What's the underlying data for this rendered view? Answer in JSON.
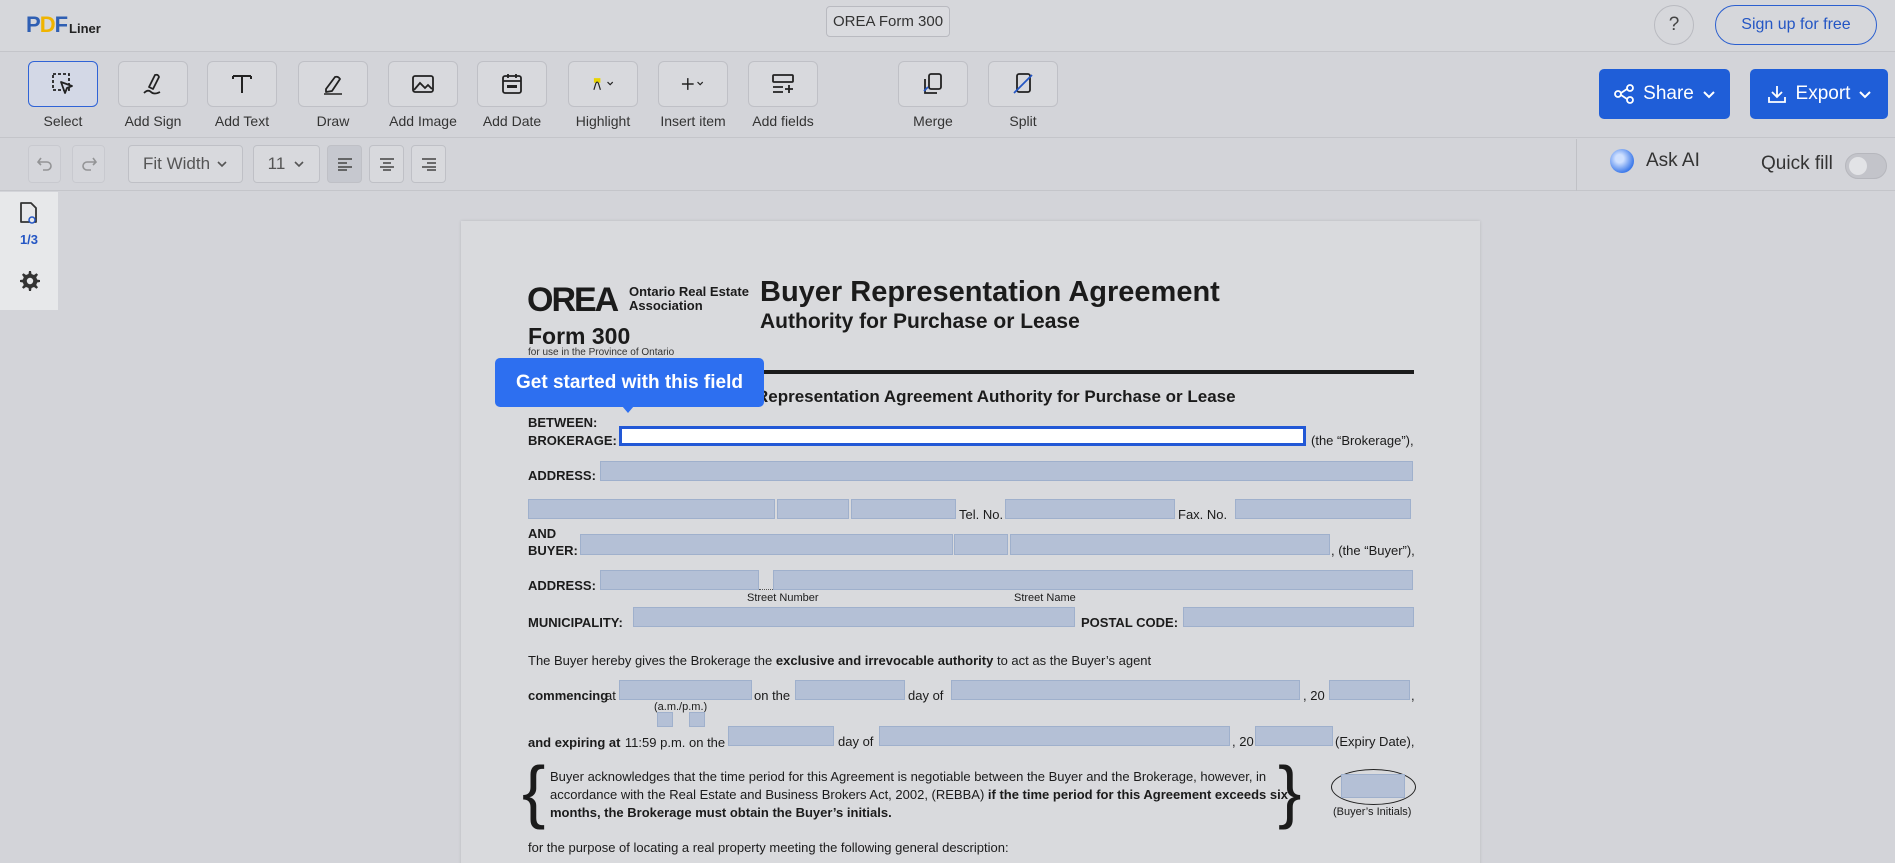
{
  "header": {
    "logo_pdf_p": "P",
    "logo_pdf_d": "D",
    "logo_pdf_f": "F",
    "logo_liner": "Liner",
    "doc_title": "OREA Form 300",
    "help": "?",
    "signup": "Sign up for free"
  },
  "toolbar": {
    "tools": [
      {
        "label": "Select",
        "icon": "select-icon"
      },
      {
        "label": "Add Sign",
        "icon": "pen-sign-icon"
      },
      {
        "label": "Add Text",
        "icon": "text-icon"
      },
      {
        "label": "Draw",
        "icon": "draw-icon"
      },
      {
        "label": "Add Image",
        "icon": "image-icon"
      },
      {
        "label": "Add Date",
        "icon": "calendar-icon"
      },
      {
        "label": "Highlight",
        "icon": "highlight-icon"
      },
      {
        "label": "Insert item",
        "icon": "plus-icon"
      },
      {
        "label": "Add fields",
        "icon": "fields-icon"
      },
      {
        "label": "Merge",
        "icon": "merge-icon"
      },
      {
        "label": "Split",
        "icon": "split-icon"
      }
    ],
    "share": "Share",
    "export": "Export"
  },
  "format": {
    "zoom": "Fit Width",
    "font_size": "11",
    "ask_ai": "Ask AI",
    "quick_fill": "Quick fill",
    "quick_fill_on": false
  },
  "sidebar": {
    "page_indicator": "1/3"
  },
  "tooltip": "Get started with this field",
  "form": {
    "orea_logo": "OREA",
    "assoc_line1": "Ontario Real Estate",
    "assoc_line2": "Association",
    "form_number": "Form 300",
    "form_sub": "for use in the Province of Ontario",
    "title": "Buyer Representation Agreement",
    "subtitle": "Authority for Purchase or Lease",
    "section_title": "Representation Agreement Authority for Purchase or Lease",
    "between": "BETWEEN:",
    "brokerage": "BROKERAGE:",
    "the_brokerage": "(the “Brokerage”),",
    "address": "ADDRESS:",
    "tel": "Tel. No.",
    "fax": "Fax. No.",
    "and": "AND",
    "buyer": "BUYER:",
    "the_buyer": ", (the “Buyer”),",
    "street_number": "Street Number",
    "street_name": "Street Name",
    "municipality": "MUNICIPALITY:",
    "postal_code": "POSTAL CODE:",
    "gives_pre": "The Buyer hereby gives the Brokerage the ",
    "gives_bold": "exclusive and irrevocable authority",
    "gives_post": " to act as the Buyer’s agent",
    "commencing": "commencing",
    "at": "at",
    "am_pm": "(a.m./p.m.)",
    "on_the": "on the",
    "day_of": "day of",
    "comma_20": ", 20",
    "comma": ",",
    "expiring_bold": "and expiring at",
    "expiring_time": "11:59 p.m. on the",
    "comma_20b": ", 20",
    "expiry_date": "(Expiry Date),",
    "ack_line1": "Buyer acknowledges that the time period for this Agreement is negotiable between the Buyer and the Brokerage, however, in",
    "ack_line2_pre": "accordance with the Real Estate and Business Brokers Act, 2002, (REBBA) ",
    "ack_line2_bold": "if the time period for this Agreement exceeds six",
    "ack_line3": "months, the Brokerage must obtain the Buyer’s initials.",
    "buyers_initials": "(Buyer’s Initials)",
    "purpose": "for the purpose of locating a real property meeting the following general description:"
  }
}
